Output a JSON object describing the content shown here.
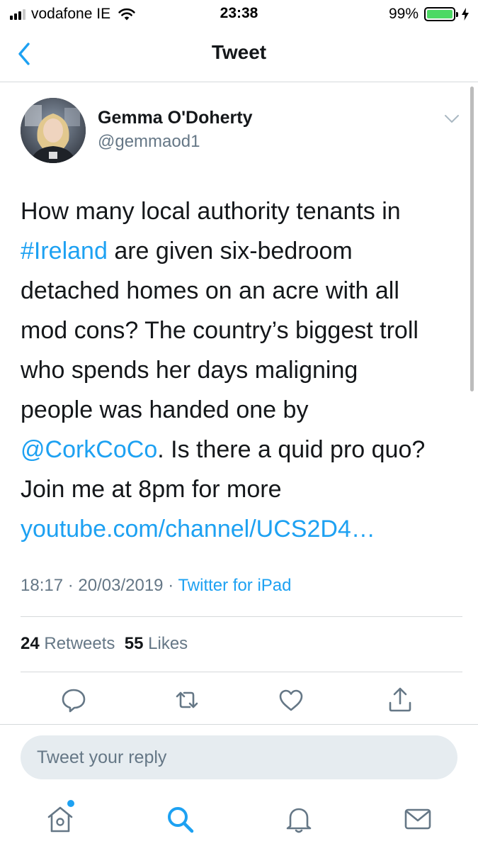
{
  "status_bar": {
    "carrier": "vodafone IE",
    "time": "23:38",
    "battery": "99%",
    "battery_level": 0.99
  },
  "nav": {
    "title": "Tweet",
    "back_icon": "chevron-left-icon"
  },
  "tweet": {
    "author_name": "Gemma O'Doherty",
    "author_handle": "@gemmaod1",
    "text_lines": [
      [
        "How many local authority tenants in"
      ],
      [
        "#Ireland",
        " are given six-bedroom"
      ],
      [
        "detached homes on an acre with all"
      ],
      [
        "mod cons? The country’s biggest troll"
      ],
      [
        "who spends her days maligning"
      ],
      [
        "people was handed one by"
      ],
      [
        "@CorkCoCo",
        ". Is there a quid pro quo?"
      ],
      [
        "Join me at 8pm for more"
      ],
      [
        "youtube.com/channel/UCS2D4…"
      ]
    ],
    "time": "18:17",
    "date": "20/03/2019",
    "separator": "·",
    "source": "Twitter for iPad",
    "retweets_count": "24",
    "retweets_label": "Retweets",
    "likes_count": "55",
    "likes_label": "Likes"
  },
  "actions": [
    "reply-icon",
    "retweet-icon",
    "like-icon",
    "share-icon"
  ],
  "reply": {
    "placeholder": "Tweet your reply"
  },
  "tabs": [
    "home-icon",
    "search-icon",
    "notifications-icon",
    "messages-icon"
  ],
  "colors": {
    "accent": "#1da1f2",
    "secondary_text": "#657786",
    "battery": "#4cd964"
  }
}
